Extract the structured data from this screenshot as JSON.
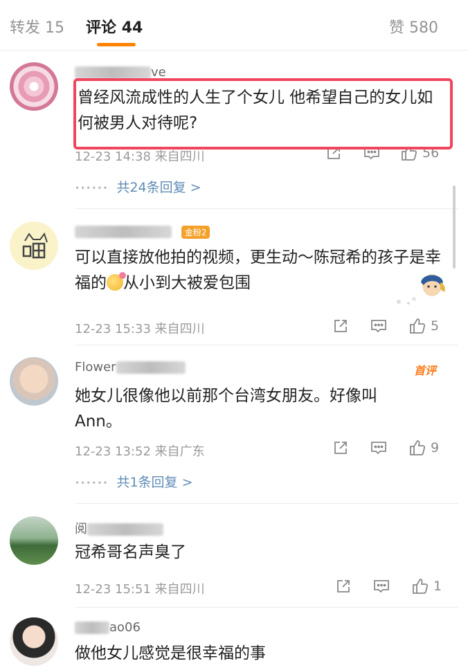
{
  "tabs": [
    {
      "label": "转发",
      "count": "15"
    },
    {
      "label": "评论",
      "count": "44"
    },
    {
      "label": "赞",
      "count": "580"
    }
  ],
  "colors": {
    "accent": "#ff8200",
    "highlight": "#f0455c",
    "link": "#5f8bb5"
  },
  "comments": [
    {
      "username_visible": "ve",
      "text": "曾经风流成性的人生了个女儿 他希望自己的女儿如何被男人对待呢?",
      "time": "12-23 14:38",
      "location": "来自四川",
      "likes": "56",
      "replies": "共24条回复 >"
    },
    {
      "badge": "金粉2",
      "text_a": "可以直接放他拍的视频，更生动～陈冠希的孩子是幸福的",
      "text_b": "从小到大被爱包围",
      "time": "12-23 15:33",
      "location": "来自四川",
      "likes": "5"
    },
    {
      "username_visible": "Flower",
      "first_badge": "首评",
      "text": "她女儿很像他以前那个台湾女朋友。好像叫Ann。",
      "time": "12-23 13:52",
      "location": "来自广东",
      "likes": "9",
      "replies": "共1条回复 >"
    },
    {
      "username_visible": "阅",
      "text": "冠希哥名声臭了",
      "time": "12-23 15:51",
      "location": "来自四川",
      "likes": "1"
    },
    {
      "username_visible": "ao06",
      "text": "做他女儿感觉是很幸福的事"
    }
  ],
  "icons": {
    "share": "share-icon",
    "comment": "comment-icon",
    "like": "thumbs-up-icon"
  }
}
